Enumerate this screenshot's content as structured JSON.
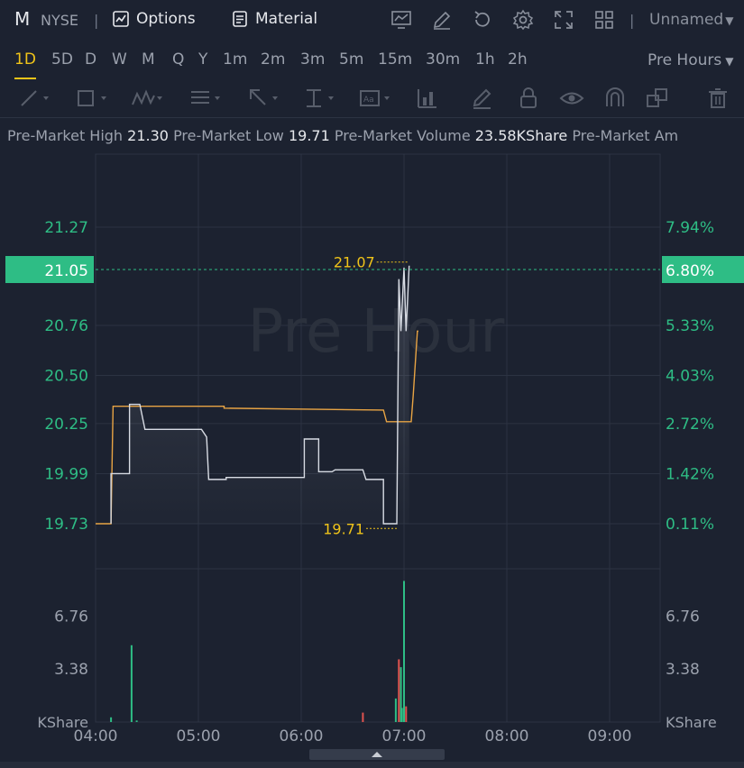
{
  "header": {
    "ticker": "M",
    "exchange": "NYSE",
    "options_label": "Options",
    "material_label": "Material",
    "layout_name": "Unnamed"
  },
  "intervals": [
    "1D",
    "5D",
    "D",
    "W",
    "M",
    "Q",
    "Y",
    "1m",
    "2m",
    "3m",
    "5m",
    "15m",
    "30m",
    "1h",
    "2h"
  ],
  "active_interval": "1D",
  "session_label": "Pre Hours",
  "stats": [
    {
      "label": "Pre-Market High",
      "value": "21.30"
    },
    {
      "label": "Pre-Market Low",
      "value": "19.71"
    },
    {
      "label": "Pre-Market Volume",
      "value": "23.58KShare"
    },
    {
      "label": "Pre-Market Am",
      "value": ""
    }
  ],
  "watermark": "Pre Hour",
  "colors": {
    "accent": "#f0c419",
    "up": "#2ebd85",
    "down": "#e0534f",
    "avg": "#e8a444",
    "price": "#d8dce4"
  },
  "chart_data": {
    "type": "line",
    "x_ticks": [
      "04:00",
      "05:00",
      "06:00",
      "07:00",
      "08:00",
      "09:00"
    ],
    "price_axis": {
      "ticks": [
        "21.27",
        "20.76",
        "20.50",
        "20.25",
        "19.99",
        "19.73"
      ],
      "pct_ticks": [
        "7.94%",
        "5.33%",
        "4.03%",
        "2.72%",
        "1.42%",
        "0.11%"
      ],
      "ylim": [
        19.73,
        21.27
      ],
      "current_price": "21.05",
      "current_pct": "6.80%"
    },
    "high_label": "21.07",
    "low_label": "19.71",
    "price_series": [
      [
        4.15,
        19.73
      ],
      [
        4.15,
        19.99
      ],
      [
        4.33,
        19.99
      ],
      [
        4.33,
        20.35
      ],
      [
        4.43,
        20.35
      ],
      [
        4.48,
        20.22
      ],
      [
        5.03,
        20.22
      ],
      [
        5.08,
        20.18
      ],
      [
        5.1,
        19.96
      ],
      [
        5.27,
        19.96
      ],
      [
        5.27,
        19.97
      ],
      [
        6.0,
        19.97
      ],
      [
        6.03,
        19.97
      ],
      [
        6.03,
        20.17
      ],
      [
        6.17,
        20.17
      ],
      [
        6.17,
        20.0
      ],
      [
        6.3,
        20.0
      ],
      [
        6.33,
        20.01
      ],
      [
        6.6,
        20.01
      ],
      [
        6.63,
        19.96
      ],
      [
        6.8,
        19.96
      ],
      [
        6.8,
        19.73
      ],
      [
        6.93,
        19.73
      ],
      [
        6.95,
        21.0
      ],
      [
        6.97,
        20.73
      ],
      [
        7.0,
        21.06
      ],
      [
        7.02,
        20.73
      ],
      [
        7.05,
        21.07
      ]
    ],
    "avg_series": [
      [
        4.0,
        19.73
      ],
      [
        4.15,
        19.73
      ],
      [
        4.17,
        20.34
      ],
      [
        5.25,
        20.34
      ],
      [
        5.25,
        20.33
      ],
      [
        6.8,
        20.32
      ],
      [
        6.83,
        20.26
      ],
      [
        7.07,
        20.26
      ],
      [
        7.09,
        20.4
      ],
      [
        7.13,
        20.73
      ],
      [
        7.14,
        20.73
      ]
    ],
    "volume_axis": {
      "ticks": [
        "6.76",
        "3.38"
      ],
      "ylim": [
        0,
        9.2
      ],
      "unit": "KShare"
    },
    "volume_bars": [
      {
        "t": 4.15,
        "v": 0.3,
        "c": "up"
      },
      {
        "t": 4.35,
        "v": 4.9,
        "c": "up"
      },
      {
        "t": 4.4,
        "v": 0.1,
        "c": "up"
      },
      {
        "t": 6.6,
        "v": 0.6,
        "c": "down"
      },
      {
        "t": 6.92,
        "v": 1.5,
        "c": "up"
      },
      {
        "t": 6.95,
        "v": 4.0,
        "c": "down"
      },
      {
        "t": 6.97,
        "v": 3.5,
        "c": "up"
      },
      {
        "t": 6.98,
        "v": 0.9,
        "c": "up"
      },
      {
        "t": 7.0,
        "v": 9.0,
        "c": "up"
      },
      {
        "t": 7.02,
        "v": 1.0,
        "c": "down"
      }
    ]
  }
}
